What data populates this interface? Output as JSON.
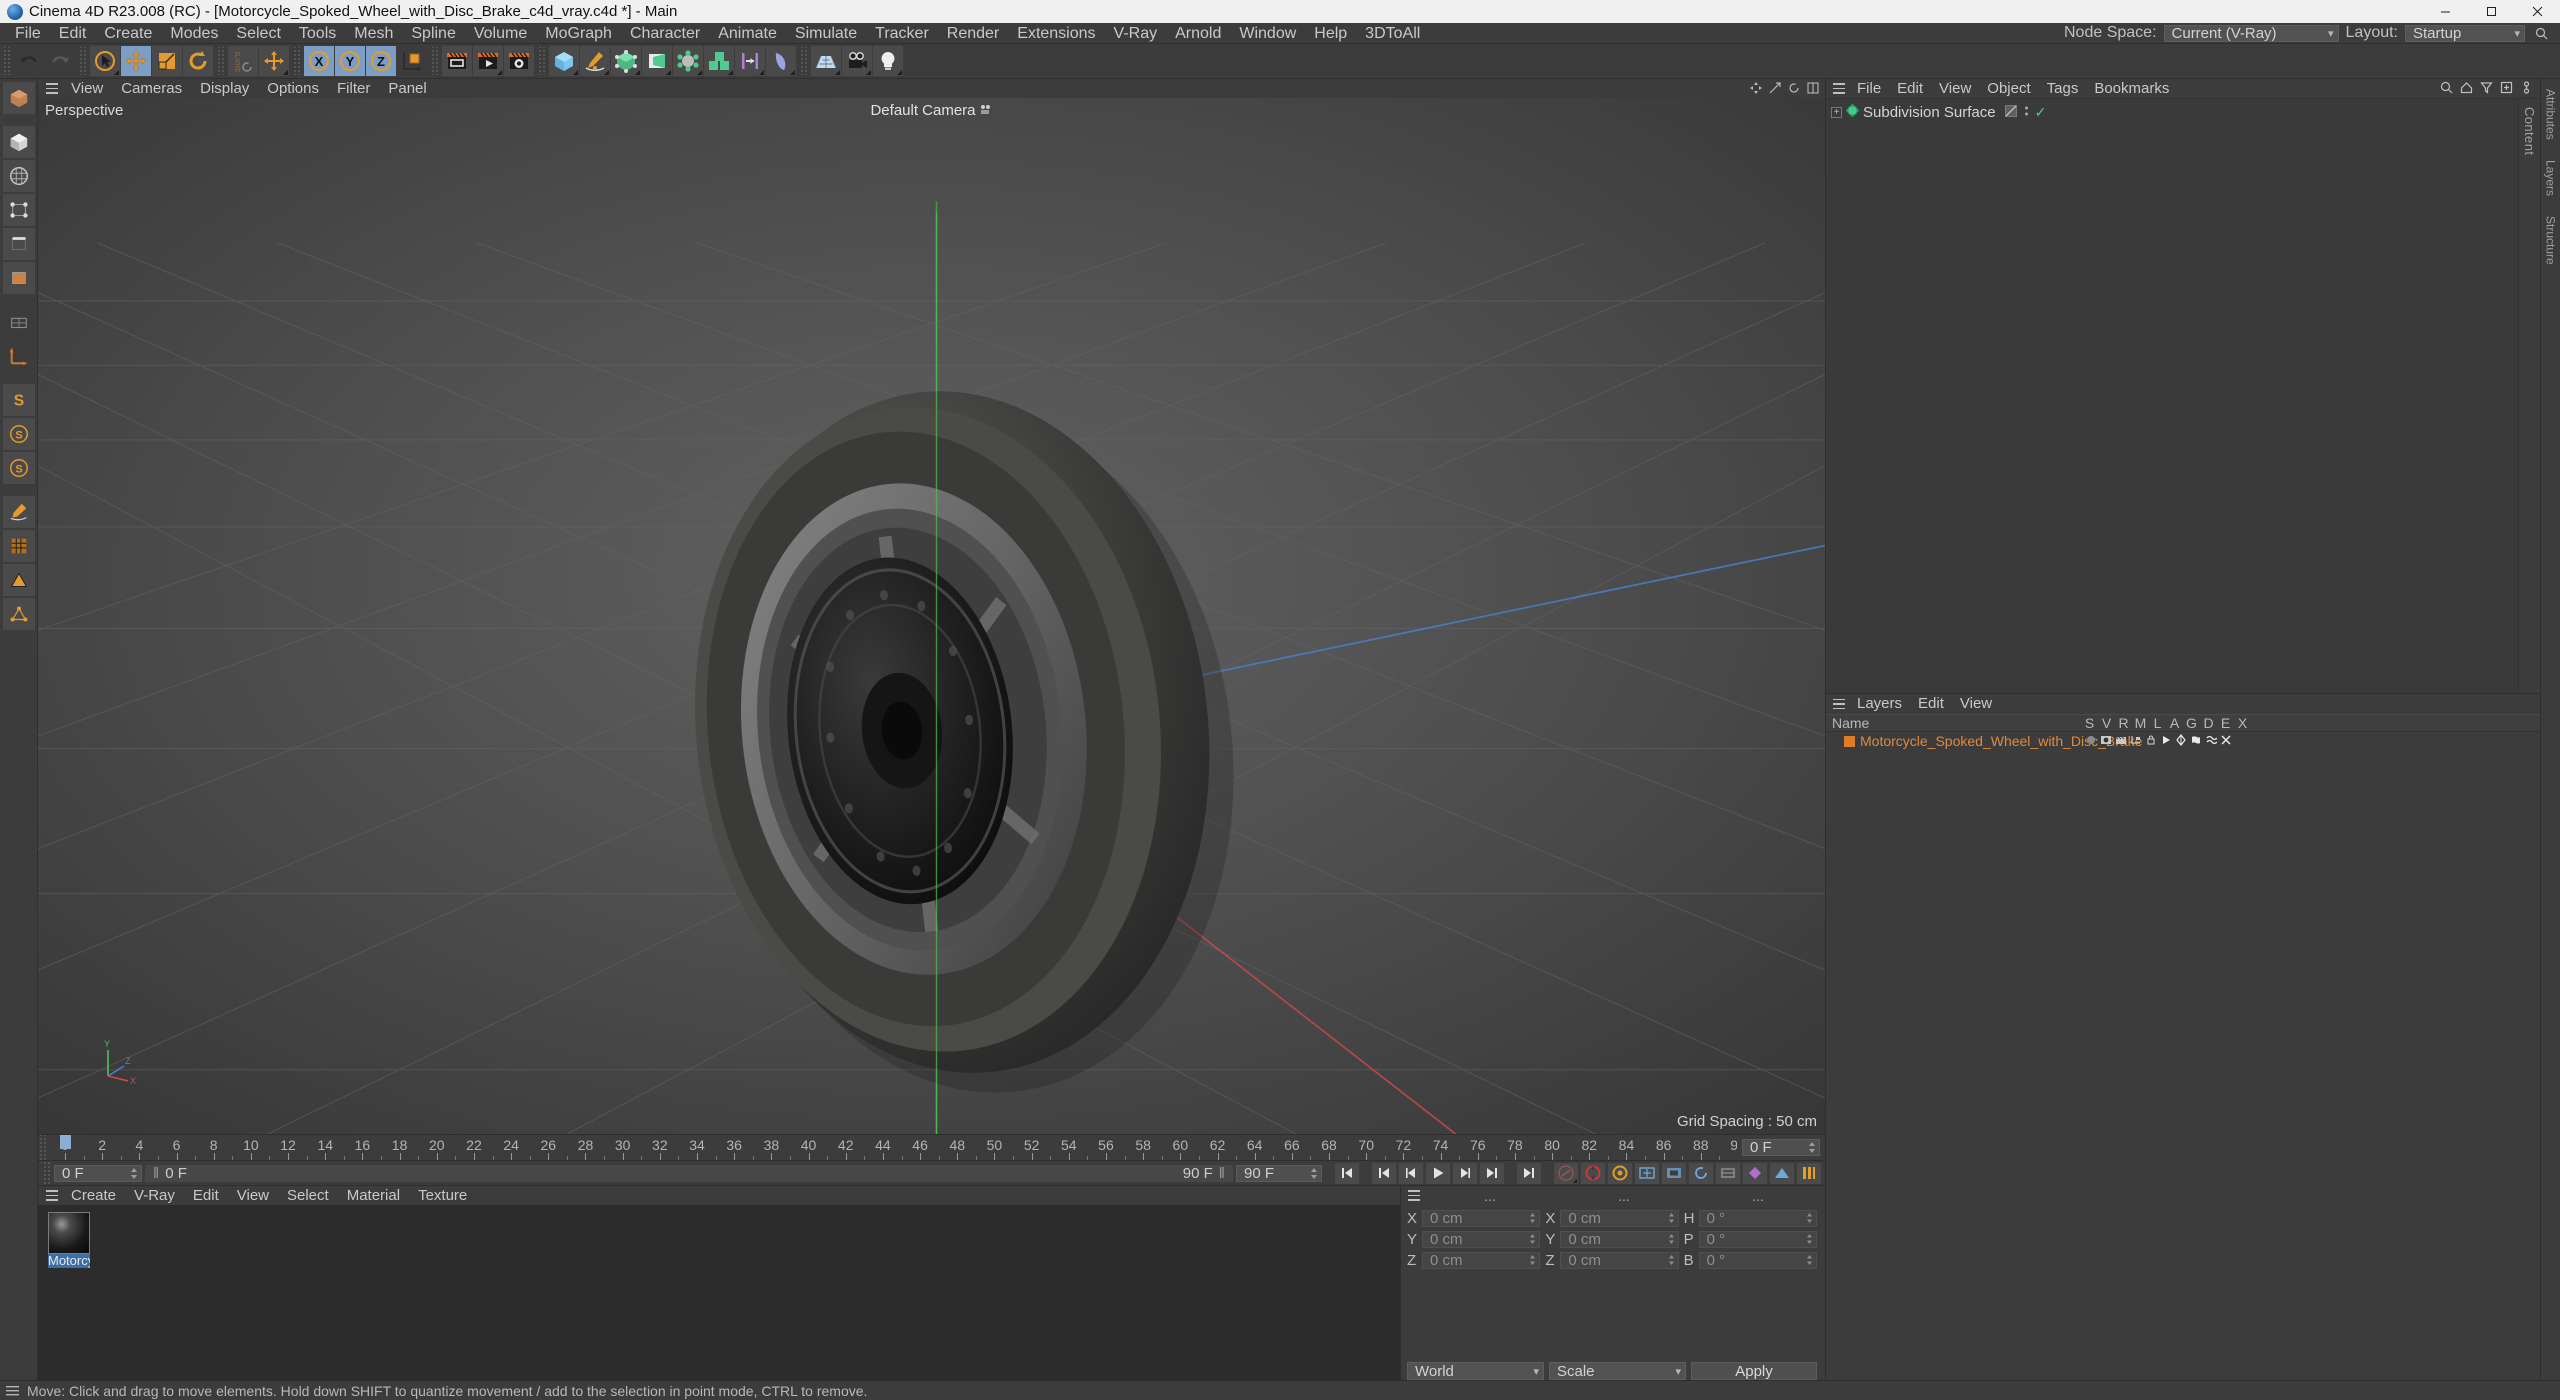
{
  "window": {
    "title": "Cinema 4D R23.008 (RC) - [Motorcycle_Spoked_Wheel_with_Disc_Brake_c4d_vray.c4d *] - Main",
    "minimize": "minimize-icon",
    "maximize": "maximize-icon",
    "close": "close-icon"
  },
  "menubar": {
    "items": [
      "File",
      "Edit",
      "Create",
      "Modes",
      "Select",
      "Tools",
      "Mesh",
      "Spline",
      "Volume",
      "MoGraph",
      "Character",
      "Animate",
      "Simulate",
      "Tracker",
      "Render",
      "Extensions",
      "V-Ray",
      "Arnold",
      "Window",
      "Help",
      "3DToAll"
    ],
    "node_space_label": "Node Space:",
    "node_space_value": "Current (V-Ray)",
    "layout_label": "Layout:",
    "layout_value": "Startup"
  },
  "toolbar": {
    "groups": [
      {
        "name": "history",
        "buttons": [
          {
            "icon": "undo-icon",
            "active": false
          },
          {
            "icon": "redo-icon",
            "active": false
          }
        ]
      },
      {
        "name": "tools",
        "buttons": [
          {
            "icon": "live-selection-icon",
            "active": false
          },
          {
            "icon": "move-tool-icon",
            "active": true
          },
          {
            "icon": "scale-tool-icon",
            "active": false
          },
          {
            "icon": "rotate-tool-icon",
            "active": false
          }
        ]
      },
      {
        "name": "psr",
        "buttons": [
          {
            "icon": "psr-icon",
            "active": false
          },
          {
            "icon": "move-icon",
            "active": false
          }
        ]
      },
      {
        "name": "axislocks",
        "buttons": [
          {
            "icon": "lock-x-icon",
            "active": true
          },
          {
            "icon": "lock-y-icon",
            "active": true
          },
          {
            "icon": "lock-z-icon",
            "active": true
          },
          {
            "icon": "world-object-coord-icon",
            "active": false
          }
        ]
      },
      {
        "name": "render",
        "buttons": [
          {
            "icon": "render-view-icon",
            "active": false
          },
          {
            "icon": "render-queue-icon",
            "active": false
          },
          {
            "icon": "render-settings-icon",
            "active": false
          }
        ]
      },
      {
        "name": "create",
        "buttons": [
          {
            "icon": "cube-primitive-icon",
            "active": false
          },
          {
            "icon": "spline-pen-icon",
            "active": false
          },
          {
            "icon": "nurbs-generator-icon",
            "active": false
          },
          {
            "icon": "subdivision-surface-icon",
            "active": false
          },
          {
            "icon": "array-icon",
            "active": false
          },
          {
            "icon": "mograph-cloner-icon",
            "active": false
          },
          {
            "icon": "deformer-icon",
            "active": false
          },
          {
            "icon": "bend-deformer-icon",
            "active": false
          }
        ]
      },
      {
        "name": "scene",
        "buttons": [
          {
            "icon": "floor-environment-icon",
            "active": false
          },
          {
            "icon": "camera-icon",
            "active": false
          },
          {
            "icon": "light-icon",
            "active": false
          }
        ]
      }
    ]
  },
  "leftbar": {
    "buttons": [
      {
        "icon": "editable-object-icon"
      },
      {
        "icon": "model-mode-icon"
      },
      {
        "icon": "texture-mode-icon"
      },
      {
        "icon": "point-mode-icon"
      },
      {
        "icon": "edge-mode-icon"
      },
      {
        "icon": "polygon-mode-icon"
      },
      {
        "icon": "workplane-icon"
      },
      {
        "icon": "axis-modify-icon"
      },
      {
        "icon": "enable-axis-icon"
      },
      {
        "icon": "snap-s-icon"
      },
      {
        "icon": "quantize-s-icon"
      },
      {
        "icon": "workplane-s-icon"
      },
      {
        "icon": "paint-icon"
      },
      {
        "icon": "texture-grid-icon"
      },
      {
        "icon": "uv-polygon-icon"
      },
      {
        "icon": "uv-point-icon"
      }
    ]
  },
  "viewport": {
    "menu": [
      "View",
      "Cameras",
      "Display",
      "Options",
      "Filter",
      "Panel"
    ],
    "label": "Perspective",
    "camera": "Default Camera",
    "grid_spacing": "Grid Spacing : 50 cm",
    "axis_labels": [
      "Y",
      "Z",
      "X"
    ],
    "icons": [
      "viewport-move-icon",
      "viewport-scale-icon",
      "viewport-rotate-icon",
      "viewport-maximize-icon"
    ]
  },
  "timeline": {
    "start": 0,
    "end": 90,
    "step": 2,
    "current_frame": "0 F",
    "field_right": "0 F"
  },
  "playbar": {
    "current_frame": "0 F",
    "preview_range": "0 F",
    "preview_end": "90 F",
    "end_frame": "90 F",
    "buttons": [
      {
        "icon": "go-to-start-icon"
      },
      {
        "icon": "go-to-previous-key-icon"
      },
      {
        "icon": "step-back-icon"
      },
      {
        "icon": "play-icon"
      },
      {
        "icon": "step-forward-icon"
      },
      {
        "icon": "go-to-next-key-icon"
      },
      {
        "icon": "go-to-end-icon"
      }
    ],
    "record_buttons": [
      {
        "icon": "record-key-icon",
        "color": "#8a5757"
      },
      {
        "icon": "autokey-icon",
        "color": "#d0383c"
      },
      {
        "icon": "keyframe-selection-icon",
        "color": "#e0a028"
      },
      {
        "icon": "position-key-icon",
        "color": "#6fa8d8"
      },
      {
        "icon": "scale-key-icon",
        "color": "#6fa8d8"
      },
      {
        "icon": "rotation-key-icon",
        "color": "#6fa8d8"
      },
      {
        "icon": "param-key-icon",
        "color": "#9a9a9a"
      },
      {
        "icon": "pla-key-icon",
        "color": "#b06fd0"
      },
      {
        "icon": "key-mode-icon",
        "color": "#e0a028"
      },
      {
        "icon": "auto-keying-icon",
        "color": "#e0a028"
      }
    ]
  },
  "material_manager": {
    "menu": [
      "Create",
      "V-Ray",
      "Edit",
      "View",
      "Select",
      "Material",
      "Texture"
    ],
    "materials": [
      {
        "name": "Motorcy",
        "selected": true
      }
    ]
  },
  "coordinates": {
    "headers": [
      "...",
      "...",
      "..."
    ],
    "position": [
      {
        "label": "X",
        "value": "0 cm"
      },
      {
        "label": "Y",
        "value": "0 cm"
      },
      {
        "label": "Z",
        "value": "0 cm"
      }
    ],
    "size": [
      {
        "label": "X",
        "value": "0 cm"
      },
      {
        "label": "Y",
        "value": "0 cm"
      },
      {
        "label": "Z",
        "value": "0 cm"
      }
    ],
    "rotation": [
      {
        "label": "H",
        "value": "0 °"
      },
      {
        "label": "P",
        "value": "0 °"
      },
      {
        "label": "B",
        "value": "0 °"
      }
    ],
    "coord_system": "World",
    "mode": "Scale",
    "apply_label": "Apply"
  },
  "object_manager": {
    "menu": [
      "File",
      "Edit",
      "View",
      "Object",
      "Tags",
      "Bookmarks"
    ],
    "objects": [
      {
        "name": "Subdivision Surface",
        "icon": "subdivision-surface-icon",
        "expanded": false,
        "tags": [
          "phong-tag",
          "visible-check"
        ]
      }
    ],
    "icons": [
      "search-icon",
      "home-icon",
      "filter-icon",
      "add-icon",
      "settings-icon"
    ],
    "rail_tabs": [
      "Attributes",
      "Layers",
      "Structure",
      "Content"
    ]
  },
  "layers": {
    "menu": [
      "Layers",
      "Edit",
      "View"
    ],
    "columns": [
      "Name",
      "S",
      "V",
      "R",
      "M",
      "L",
      "A",
      "G",
      "D",
      "E",
      "X"
    ],
    "rows": [
      {
        "name": "Motorcycle_Spoked_Wheel_with_Disc_Brake",
        "color": "#e07b28"
      }
    ]
  },
  "statusbar": {
    "text": "Move: Click and drag to move elements. Hold down SHIFT to quantize movement / add to the selection in point mode, CTRL to remove."
  },
  "colors": {
    "accent_orange": "#e07b28",
    "active_blue": "#7c9dc4",
    "panel_bg": "#3c3c3c",
    "viewport_bg": "#4d4d4d",
    "x_axis": "#c94b4b",
    "y_axis": "#5fbf5f",
    "z_axis": "#4b80c9"
  }
}
